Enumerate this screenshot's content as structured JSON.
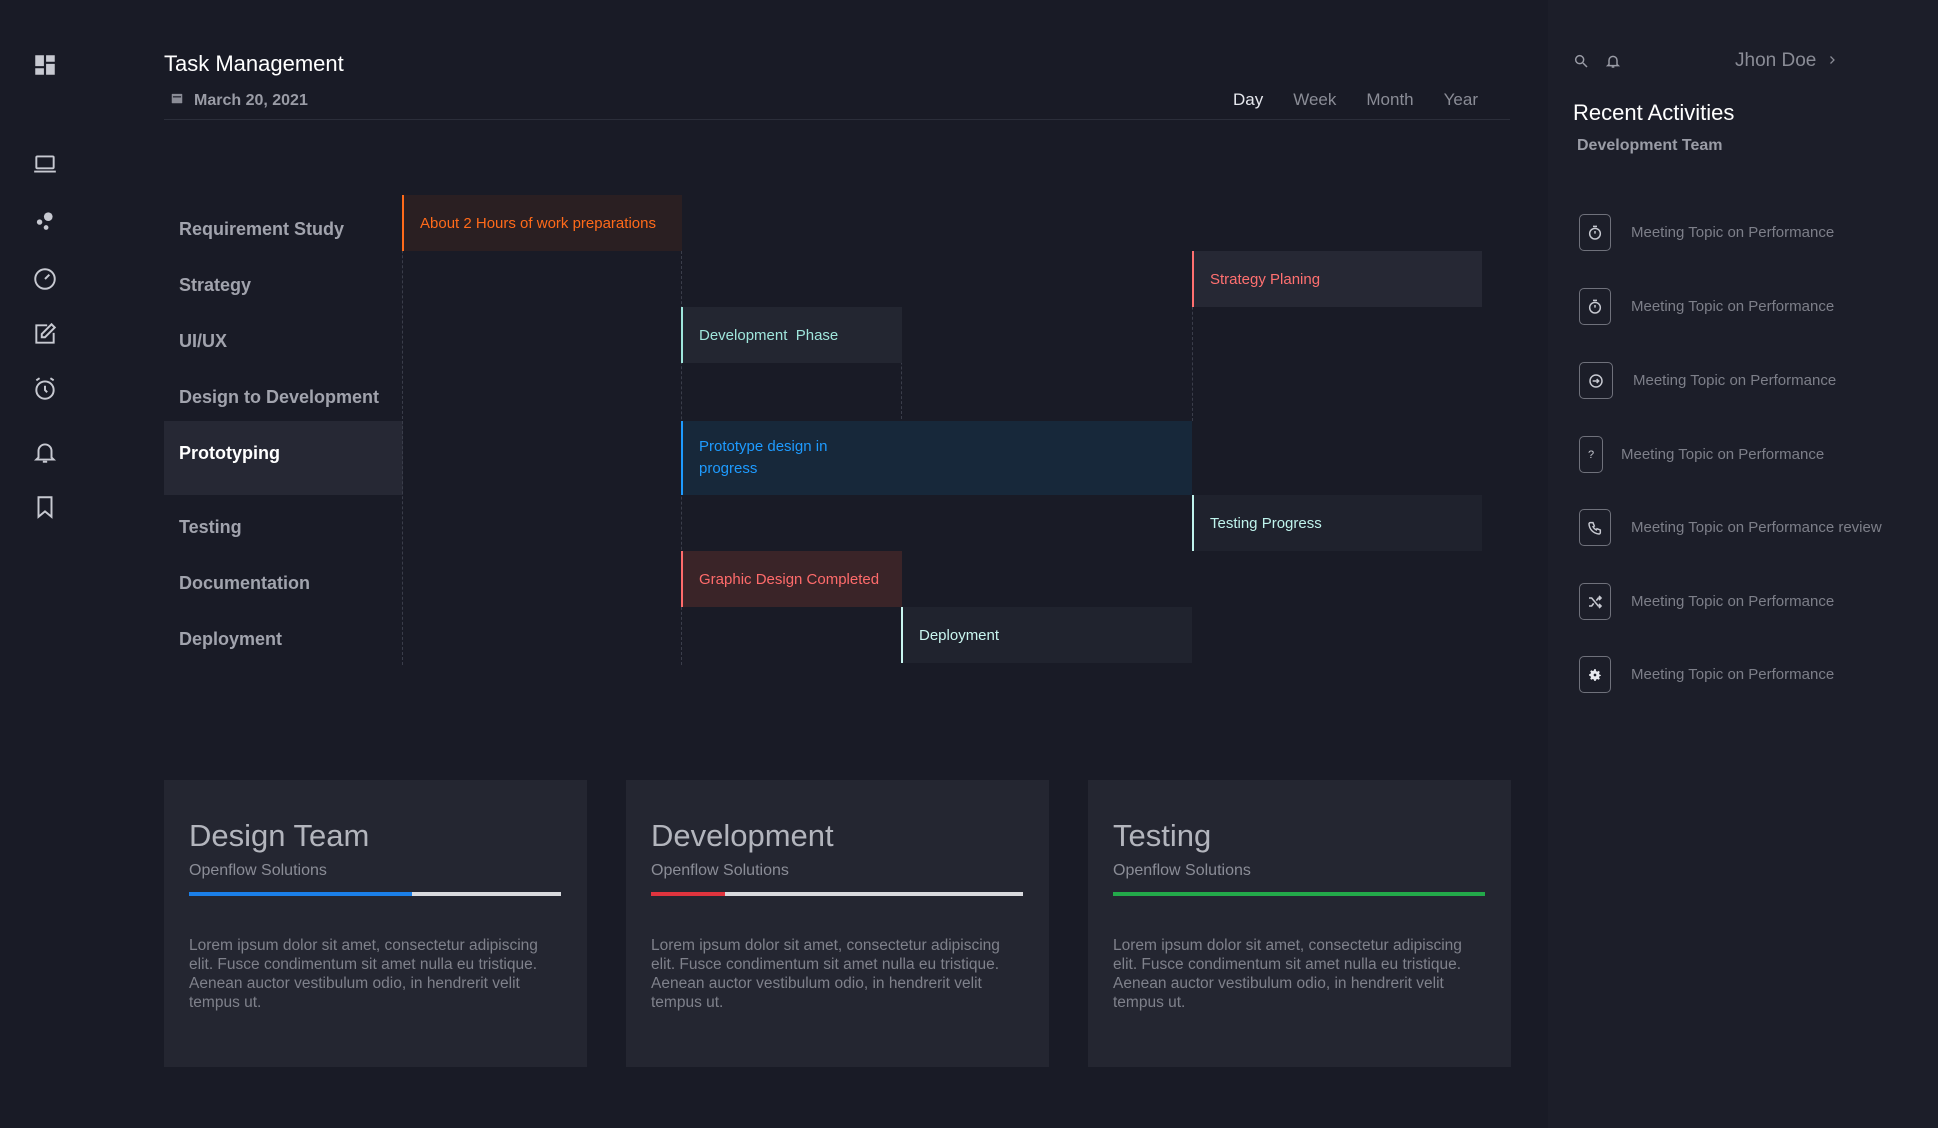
{
  "header": {
    "title": "Task Management",
    "date": "March 20, 2021",
    "views": [
      "Day",
      "Week",
      "Month",
      "Year"
    ],
    "active_view": "Day"
  },
  "sidebar": {
    "icons": [
      "dashboard-icon",
      "laptop-icon",
      "dots-icon",
      "gauge-icon",
      "edit-icon",
      "alarm-icon",
      "bell-icon",
      "bookmark-icon"
    ]
  },
  "gantt": {
    "tasks": [
      "Requirement Study",
      "Strategy",
      "UI/UX",
      "Design to Development",
      "Prototyping",
      "Testing",
      "Documentation",
      "Deployment"
    ],
    "active_task": "Prototyping",
    "bars": [
      {
        "label": "About 2 Hours of work preparations",
        "color": "#ff6a1a",
        "bg": "#2a1f22"
      },
      {
        "label": "Strategy Planing",
        "color": "#ff7070",
        "bg": "#262834"
      },
      {
        "label": "Development  Phase",
        "color": "#9fe6dc",
        "bg": "#232631"
      },
      {
        "label": "Prototype design in progress",
        "color": "#1e9bff",
        "bg": "#17283a"
      },
      {
        "label": "Testing Progress",
        "color": "#bff3ec",
        "bg": "#1f222d"
      },
      {
        "label": "Graphic Design Completed",
        "color": "#ff6b6b",
        "bg": "#3a2428"
      },
      {
        "label": "Deployment",
        "color": "#c9f6f0",
        "bg": "#20232e"
      }
    ]
  },
  "cards": [
    {
      "title": "Design Team",
      "subtitle": "Openflow Solutions",
      "progress": 0.6,
      "progress_color": "#1b7fe8",
      "text": "Lorem ipsum dolor sit amet, consectetur adipiscing elit. Fusce condimentum sit amet nulla eu tristique. Aenean auctor vestibulum odio, in hendrerit velit tempus ut."
    },
    {
      "title": "Development",
      "subtitle": "Openflow Solutions",
      "progress": 0.2,
      "progress_color": "#e0343e",
      "text": "Lorem ipsum dolor sit amet, consectetur adipiscing elit. Fusce condimentum sit amet nulla eu tristique. Aenean auctor vestibulum odio, in hendrerit velit tempus ut."
    },
    {
      "title": "Testing",
      "subtitle": "Openflow Solutions",
      "progress": 1.0,
      "progress_color": "#23a94a",
      "text": "Lorem ipsum dolor sit amet, consectetur adipiscing elit. Fusce condimentum sit amet nulla eu tristique. Aenean auctor vestibulum odio, in hendrerit velit tempus ut."
    }
  ],
  "right_panel": {
    "user": "Jhon Doe",
    "title": "Recent Activities",
    "subtitle": "Development Team",
    "activities": [
      {
        "icon": "alarm-icon",
        "text": "Meeting Topic on Performance"
      },
      {
        "icon": "alarm-icon",
        "text": "Meeting Topic on Performance"
      },
      {
        "icon": "login-icon",
        "text": "Meeting Topic on Performance"
      },
      {
        "icon": "question-icon",
        "text": "Meeting Topic on Performance"
      },
      {
        "icon": "phone-icon",
        "text": "Meeting Topic on Performance review"
      },
      {
        "icon": "shuffle-icon",
        "text": "Meeting Topic on Performance"
      },
      {
        "icon": "gear-icon",
        "text": "Meeting Topic on Performance"
      }
    ]
  }
}
